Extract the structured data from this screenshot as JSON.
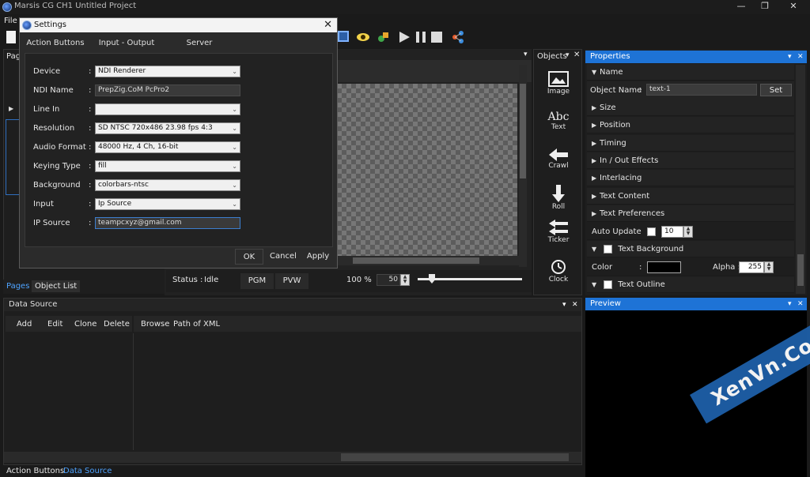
{
  "window": {
    "title": "Marsis CG CH1 Untitled Project",
    "min": "—",
    "restore": "❐",
    "close": "✕"
  },
  "menu": {
    "file": "File"
  },
  "left_panel": {
    "header_fragment": "Pag",
    "tabs": [
      "Pages",
      "Object List"
    ]
  },
  "settings": {
    "title": "Settings",
    "tabs": [
      "Action Buttons",
      "Input - Output",
      "Server"
    ],
    "fields": [
      {
        "label": "Device",
        "value": "NDI Renderer",
        "kind": "select"
      },
      {
        "label": "NDI Name",
        "value": "PrepZig.CoM   PcPro2",
        "kind": "text"
      },
      {
        "label": "Line In",
        "value": "",
        "kind": "select"
      },
      {
        "label": "Resolution",
        "value": "SD NTSC 720x486 23.98 fps 4:3",
        "kind": "select"
      },
      {
        "label": "Audio Format",
        "value": "48000 Hz, 4 Ch, 16-bit",
        "kind": "select"
      },
      {
        "label": "Keying Type",
        "value": "fill",
        "kind": "select"
      },
      {
        "label": "Background",
        "value": "colorbars-ntsc",
        "kind": "select"
      },
      {
        "label": "Input",
        "value": "Ip Source",
        "kind": "select"
      },
      {
        "label": "IP Source",
        "value": "teampcxyz@gmail.com",
        "kind": "text"
      }
    ],
    "buttons": {
      "ok": "OK",
      "cancel": "Cancel",
      "apply": "Apply"
    }
  },
  "status_bar": {
    "status_label": "Status :",
    "status_value": "Idle",
    "pgm": "PGM",
    "pvw": "PVW",
    "zoom": "100 %",
    "speed": "50"
  },
  "objects": {
    "header": "Objects",
    "items": [
      "Image",
      "Text",
      "Crawl",
      "Roll",
      "Ticker",
      "Clock"
    ]
  },
  "properties": {
    "header": "Properties",
    "name_section": "Name",
    "object_name_label": "Object Name",
    "object_name_value": "text-1",
    "set_button": "Set",
    "sections": [
      "Size",
      "Position",
      "Timing",
      "In / Out Effects",
      "Interlacing",
      "Text Content",
      "Text Preferences"
    ],
    "auto_update_label": "Auto Update",
    "auto_update_value": "10",
    "text_background": "Text Background",
    "color_label": "Color",
    "alpha_label": "Alpha :",
    "alpha_value": "255",
    "text_outline": "Text Outline"
  },
  "data_source": {
    "header": "Data Source",
    "buttons": [
      "Add",
      "Edit",
      "Clone",
      "Delete"
    ],
    "browse": "Browse",
    "path": "Path of XML"
  },
  "bottom_tabs": [
    "Action Buttons",
    "Data Source"
  ],
  "preview": {
    "header": "Preview"
  },
  "watermark": "XenVn.Com",
  "colors": {
    "accent": "#1e73d6",
    "panel": "#232323",
    "background": "#1a1a1a"
  }
}
